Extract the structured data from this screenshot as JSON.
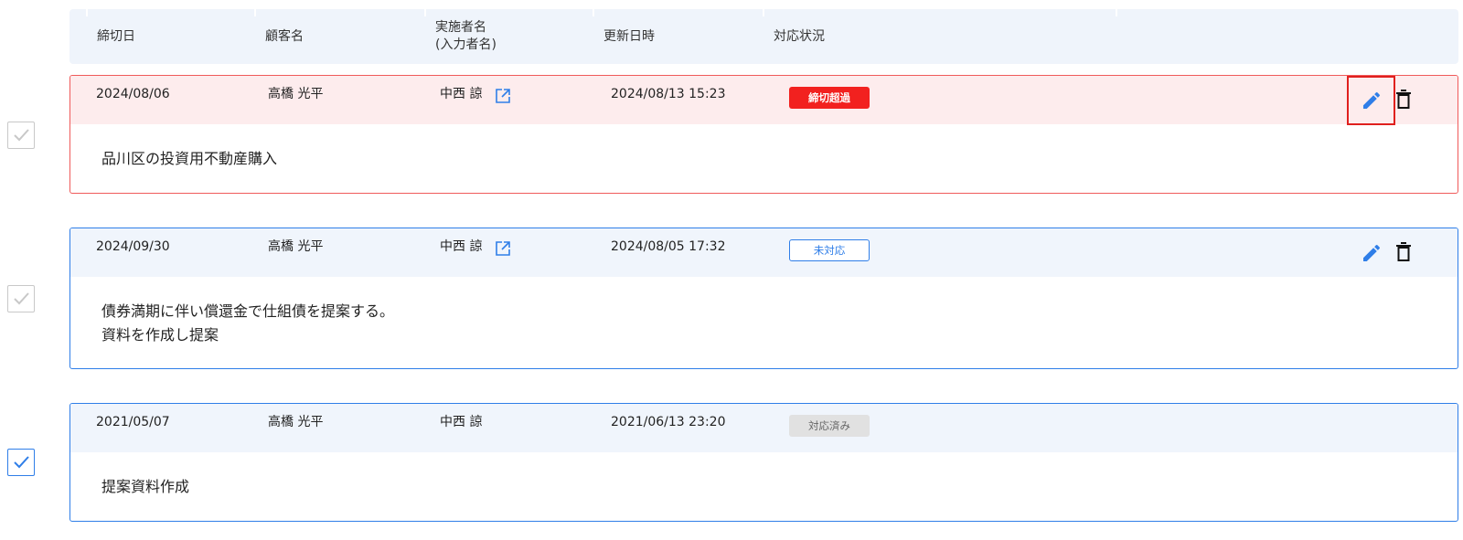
{
  "header": {
    "deadline": "締切日",
    "customer": "顧客名",
    "assignee_line1": "実施者名",
    "assignee_line2": "(入力者名)",
    "updated": "更新日時",
    "status": "対応状況"
  },
  "tasks": [
    {
      "deadline": "2024/08/06",
      "customer": "高橋 光平",
      "assignee": "中西 諒",
      "updated": "2024/08/13 15:23",
      "status": "締切超過",
      "lines": [
        "品川区の投資用不動産購入"
      ],
      "checked": false
    },
    {
      "deadline": "2024/09/30",
      "customer": "高橋 光平",
      "assignee": "中西 諒",
      "updated": "2024/08/05 17:32",
      "status": "未対応",
      "lines": [
        "債券満期に伴い償還金で仕組債を提案する。",
        "資料を作成し提案"
      ],
      "checked": false
    },
    {
      "deadline": "2021/05/07",
      "customer": "高橋 光平",
      "assignee": "中西 諒",
      "updated": "2021/06/13 23:20",
      "status": "対応済み",
      "lines": [
        "提案資料作成"
      ],
      "checked": true
    }
  ],
  "colors": {
    "accent": "#2f7ee8",
    "overdue": "#f2211f",
    "header_bg": "#eff4fb",
    "done_badge": "#e1e1e1"
  },
  "icons": {
    "external": "external-link-icon",
    "edit": "pencil-icon",
    "delete": "trash-icon",
    "check": "checkmark-icon"
  }
}
